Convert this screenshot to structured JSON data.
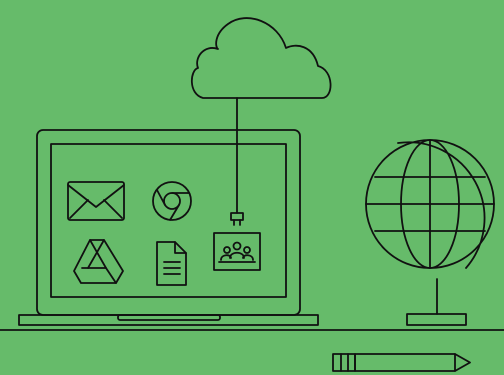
{
  "scene": {
    "background_color": "#66bb6a",
    "line_color": "#111111",
    "icons": [
      {
        "name": "gmail-icon"
      },
      {
        "name": "chrome-icon"
      },
      {
        "name": "drive-icon"
      },
      {
        "name": "docs-icon"
      },
      {
        "name": "classroom-icon"
      }
    ],
    "objects": [
      "cloud",
      "laptop",
      "globe",
      "pencil",
      "desk-line"
    ]
  }
}
